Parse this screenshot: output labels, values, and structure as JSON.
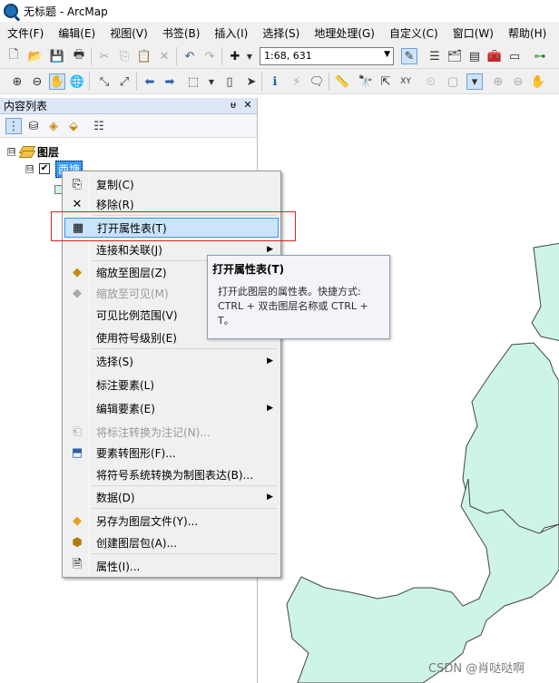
{
  "window": {
    "title": "无标题 - ArcMap"
  },
  "menu": [
    "文件(F)",
    "编辑(E)",
    "视图(V)",
    "书签(B)",
    "插入(I)",
    "选择(S)",
    "地理处理(G)",
    "自定义(C)",
    "窗口(W)",
    "帮助(H)"
  ],
  "toolbar": {
    "scale_value": "1:68, 631"
  },
  "toc": {
    "title": "内容列表",
    "pin_label": "ᵾ",
    "close_label": "✕",
    "root": {
      "label": "图层",
      "expander": "⊟"
    },
    "layer": {
      "label": "西塘",
      "checked": "✔",
      "expander": "⊟"
    }
  },
  "context_menu": {
    "items": [
      {
        "label": "复制(C)",
        "icon": "copy-icon"
      },
      {
        "label": "移除(R)",
        "icon": "remove-icon"
      },
      {
        "label": "打开属性表(T)",
        "icon": "table-icon"
      },
      {
        "label": "连接和关联(J)",
        "icon": "",
        "submenu": "▶"
      },
      {
        "label": "缩放至图层(Z)",
        "icon": "zoom-layer-icon"
      },
      {
        "label": "缩放至可见(M)",
        "icon": "zoom-visible-icon"
      },
      {
        "label": "可见比例范围(V)",
        "icon": "",
        "submenu": "▶"
      },
      {
        "label": "使用符号级别(E)",
        "icon": ""
      },
      {
        "label": "选择(S)",
        "icon": "",
        "submenu": "▶"
      },
      {
        "label": "标注要素(L)",
        "icon": ""
      },
      {
        "label": "编辑要素(E)",
        "icon": "",
        "submenu": "▶"
      },
      {
        "label": "将标注转换为注记(N)...",
        "icon": "convert-labels-icon"
      },
      {
        "label": "要素转图形(F)...",
        "icon": "features-to-graphics-icon"
      },
      {
        "label": "将符号系统转换为制图表达(B)...",
        "icon": ""
      },
      {
        "label": "数据(D)",
        "icon": "",
        "submenu": "▶"
      },
      {
        "label": "另存为图层文件(Y)...",
        "icon": "save-layer-icon"
      },
      {
        "label": "创建图层包(A)...",
        "icon": "layer-package-icon"
      },
      {
        "label": "属性(I)...",
        "icon": "properties-icon"
      }
    ]
  },
  "tooltip": {
    "title": "打开属性表(T)",
    "line1": "打开此图层的属性表。快捷方式:",
    "line2": "CTRL + 双击图层名称或 CTRL +",
    "line3": "T。"
  },
  "map": {
    "fill_color": "#cdf4e7",
    "stroke_color": "#444444"
  },
  "watermark": "CSDN @肖哒哒啊"
}
